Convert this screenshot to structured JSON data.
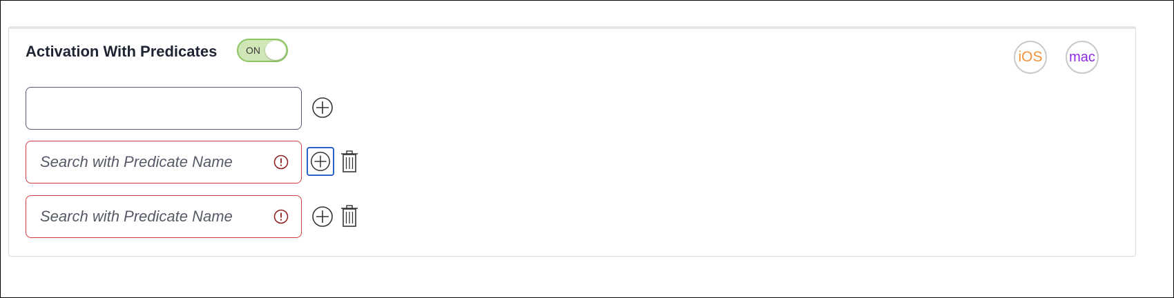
{
  "section": {
    "title": "Activation With Predicates",
    "toggle": {
      "label": "ON",
      "state": "on",
      "color": "#8cc461"
    }
  },
  "platforms": [
    {
      "label": "iOS",
      "color": "#f2923a"
    },
    {
      "label": "mac",
      "color": "#8a2be2"
    }
  ],
  "predicates": [
    {
      "value": "",
      "placeholder": "",
      "error": false,
      "icons": [
        "add-icon"
      ]
    },
    {
      "value": "",
      "placeholder": "Search with Predicate Name",
      "error": true,
      "icons": [
        "add-icon",
        "trash-icon",
        "error-icon"
      ]
    },
    {
      "value": "",
      "placeholder": "Search with Predicate Name",
      "error": true,
      "icons": [
        "add-icon",
        "trash-icon",
        "error-icon"
      ]
    }
  ],
  "colors": {
    "error_border": "#d0393b",
    "error_icon": "#8b1a1a",
    "focus_ring": "#2a62c9",
    "ios": "#f2923a",
    "mac": "#8a2be2"
  }
}
